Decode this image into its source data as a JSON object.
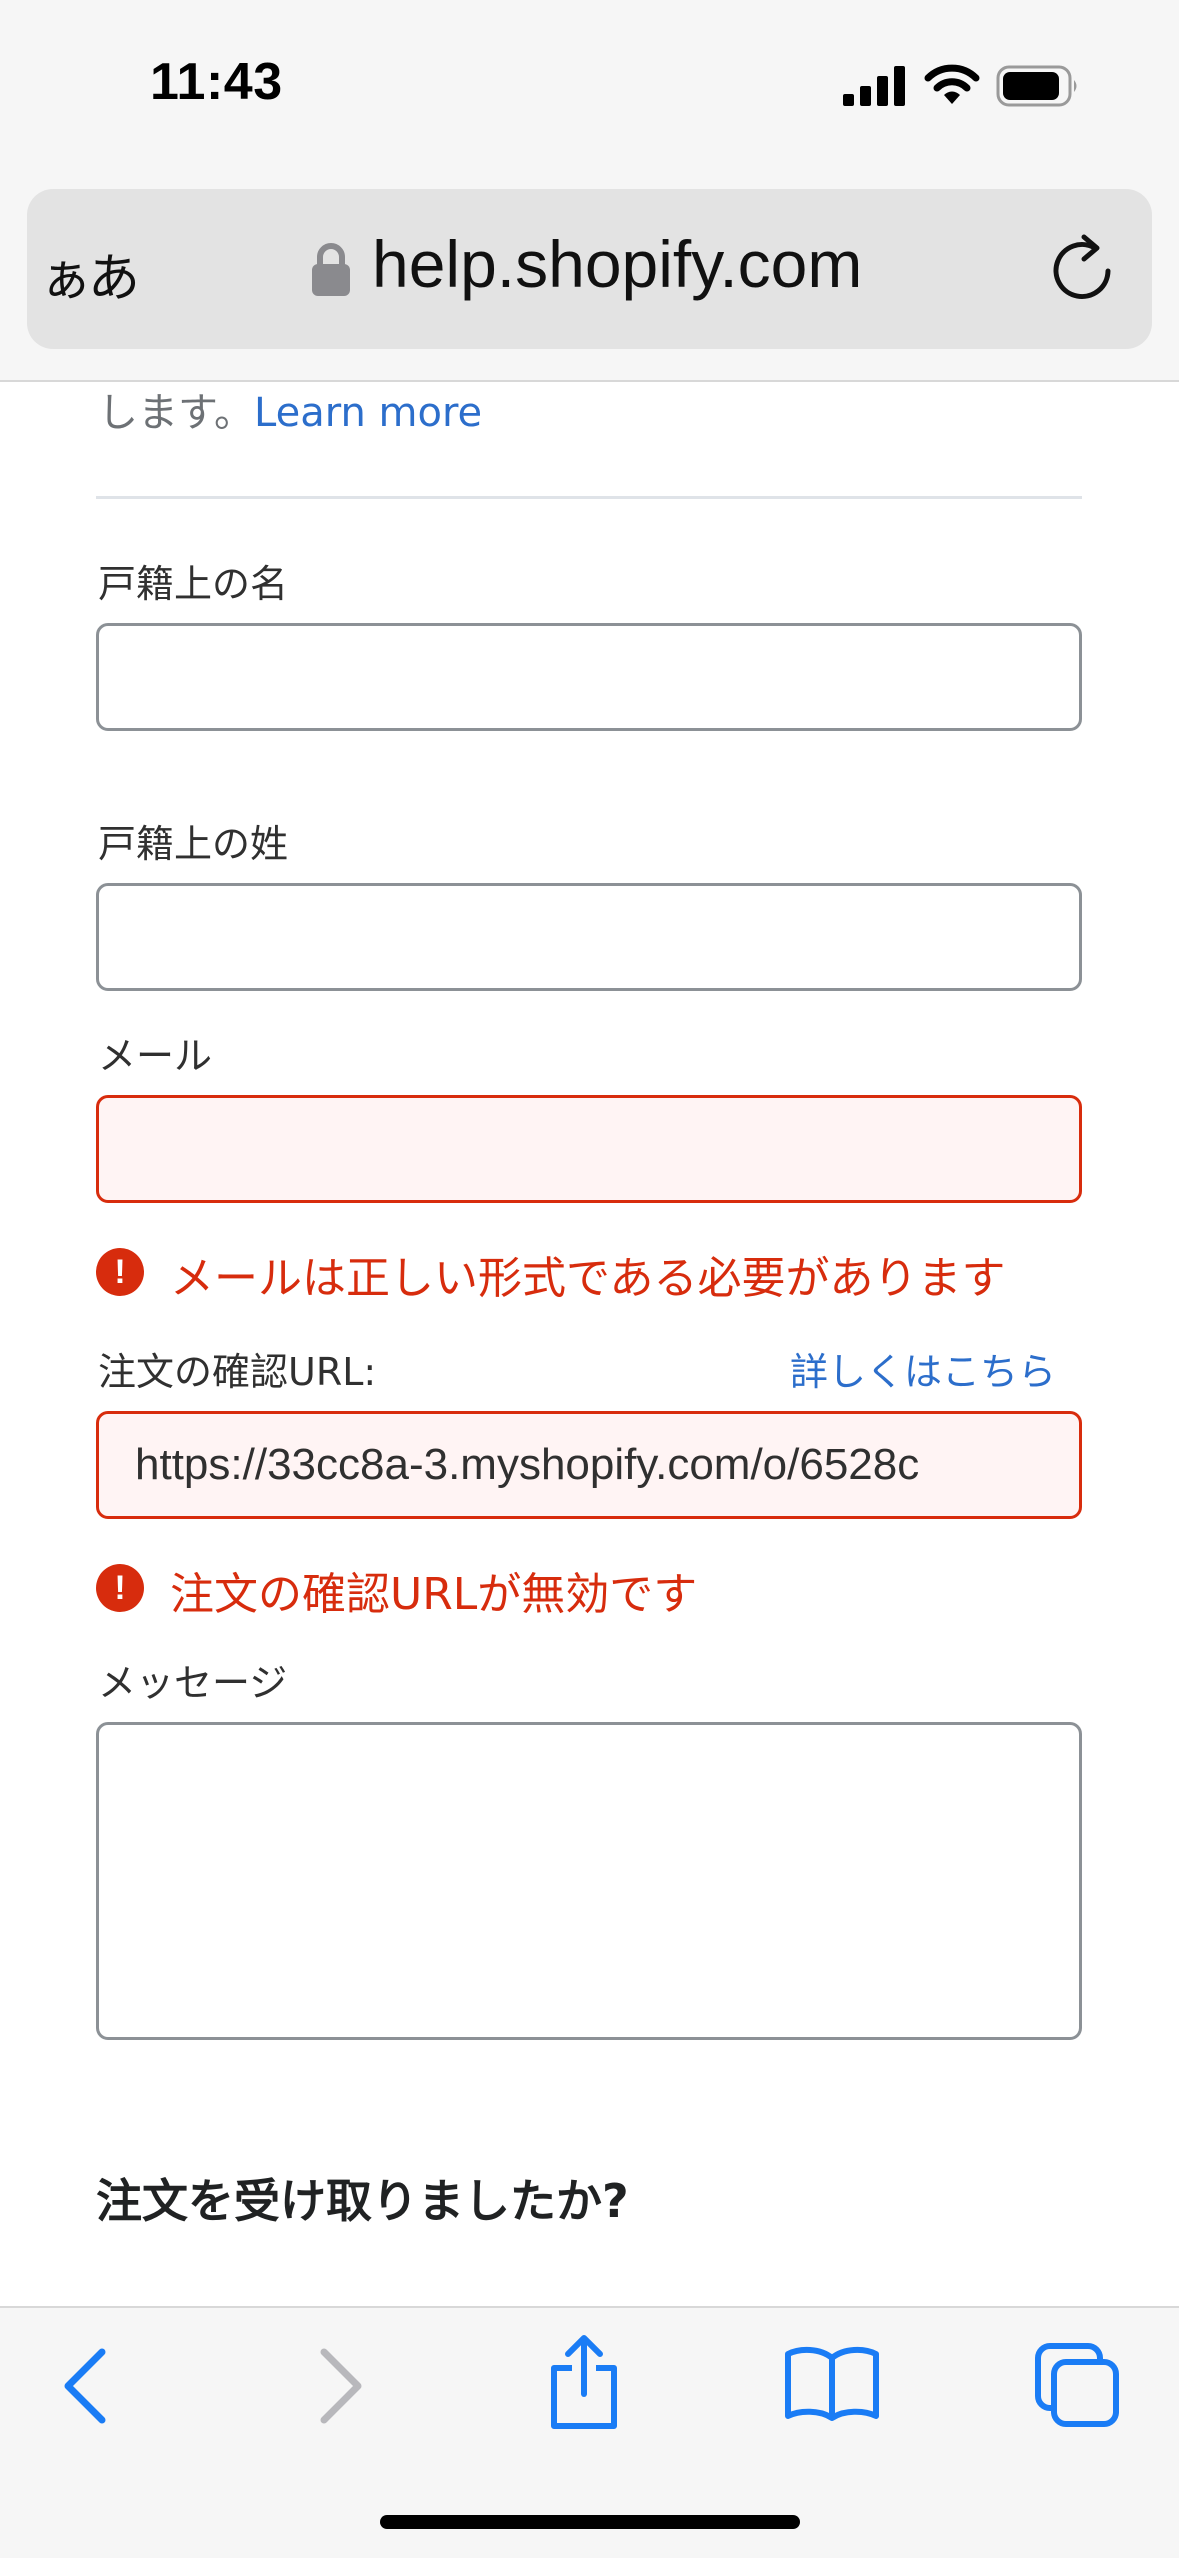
{
  "status_bar": {
    "time": "11:43"
  },
  "address_bar": {
    "reader_label": "ぁあ",
    "domain": "help.shopify.com"
  },
  "page": {
    "intro": {
      "text": "します。",
      "link": "Learn more"
    },
    "fields": {
      "first_name": {
        "label": "戸籍上の名",
        "value": ""
      },
      "last_name": {
        "label": "戸籍上の姓",
        "value": ""
      },
      "email": {
        "label": "メール",
        "value": "",
        "error": "メールは正しい形式である必要があります"
      },
      "order_url": {
        "label": "注文の確認URL:",
        "help_link": "詳しくはこちら",
        "value": "https://33cc8a-3.myshopify.com/o/6528c",
        "error": "注文の確認URLが無効です"
      },
      "message": {
        "label": "メッセージ",
        "value": ""
      }
    },
    "section_heading": "注文を受け取りましたか?"
  },
  "colors": {
    "link": "#2c6ecb",
    "error": "#d72c0d",
    "error_field_bg": "#fff4f4",
    "toolbar_icon": "#1a7cf5"
  },
  "toolbar": {
    "icons": [
      "back-icon",
      "forward-icon",
      "share-icon",
      "bookmarks-icon",
      "tabs-icon"
    ]
  }
}
